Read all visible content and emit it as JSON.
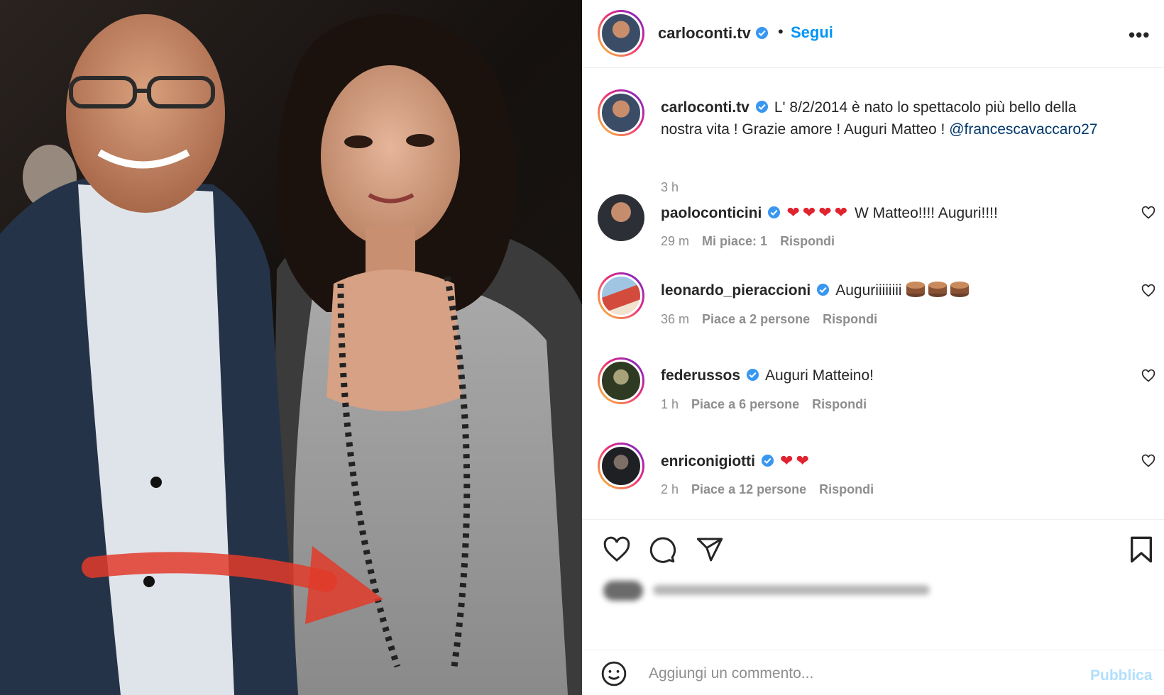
{
  "post": {
    "author": "carloconti.tv",
    "follow_label": "Segui",
    "separator": "•",
    "more_label": "•••"
  },
  "caption": {
    "username": "carloconti.tv",
    "text": "L' 8/2/2014 è nato lo spettacolo più bello della nostra vita ! Grazie amore ! Auguri Matteo !",
    "mention": "@francescavaccaro27",
    "time": "3 h"
  },
  "comments": [
    {
      "username": "paoloconticini",
      "hearts": 4,
      "text": "W Matteo!!!! Auguri!!!!",
      "time": "29 m",
      "likes": "Mi piace: 1",
      "reply": "Rispondi"
    },
    {
      "username": "leonardo_pieraccioni",
      "text": "Auguriiiiiiii",
      "cakes": 3,
      "time": "36 m",
      "likes": "Piace a 2 persone",
      "reply": "Rispondi"
    },
    {
      "username": "federussos",
      "text": "Auguri Matteino!",
      "time": "1 h",
      "likes": "Piace a 6 persone",
      "reply": "Rispondi"
    },
    {
      "username": "enriconigiotti",
      "hearts": 2,
      "text": "",
      "time": "2 h",
      "likes": "Piace a 12 persone",
      "reply": "Rispondi"
    }
  ],
  "icons": {
    "like": "heart-icon",
    "comment": "comment-icon",
    "share": "paper-plane-icon",
    "save": "bookmark-icon",
    "emoji": "smiley-icon",
    "verified": "verified-badge-icon"
  },
  "composer": {
    "placeholder": "Aggiungi un commento...",
    "publish_label": "Pubblica"
  },
  "colors": {
    "accent": "#0095f6",
    "publish_disabled": "#b2dffc",
    "heart_emoji": "#e0242f",
    "verified": "#3897f0"
  }
}
